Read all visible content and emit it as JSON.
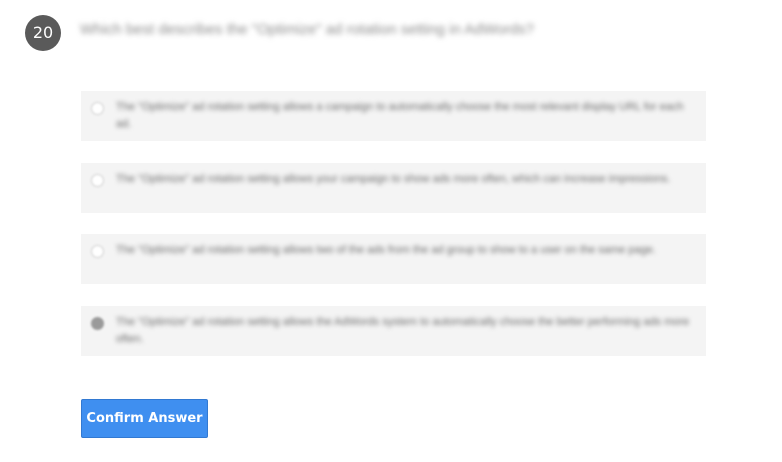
{
  "question": {
    "number": "20",
    "text": "Which best describes the \"Optimize\" ad rotation setting in AdWords?"
  },
  "options": [
    {
      "text": "The \"Optimize\" ad rotation setting allows a campaign to automatically choose the most relevant display URL for each ad.",
      "selected": false
    },
    {
      "text": "The \"Optimize\" ad rotation setting allows your campaign to show ads more often, which can increase impressions.",
      "selected": false
    },
    {
      "text": "The \"Optimize\" ad rotation setting allows two of the ads from the ad group to show to a user on the same page.",
      "selected": false
    },
    {
      "text": "The \"Optimize\" ad rotation setting allows the AdWords system to automatically choose the better performing ads more often.",
      "selected": true
    }
  ],
  "confirm_button": {
    "label": "Confirm Answer"
  },
  "colors": {
    "badge": "#5a5a5a",
    "option_bg": "#f4f4f4",
    "button": "#3f8ff0"
  }
}
